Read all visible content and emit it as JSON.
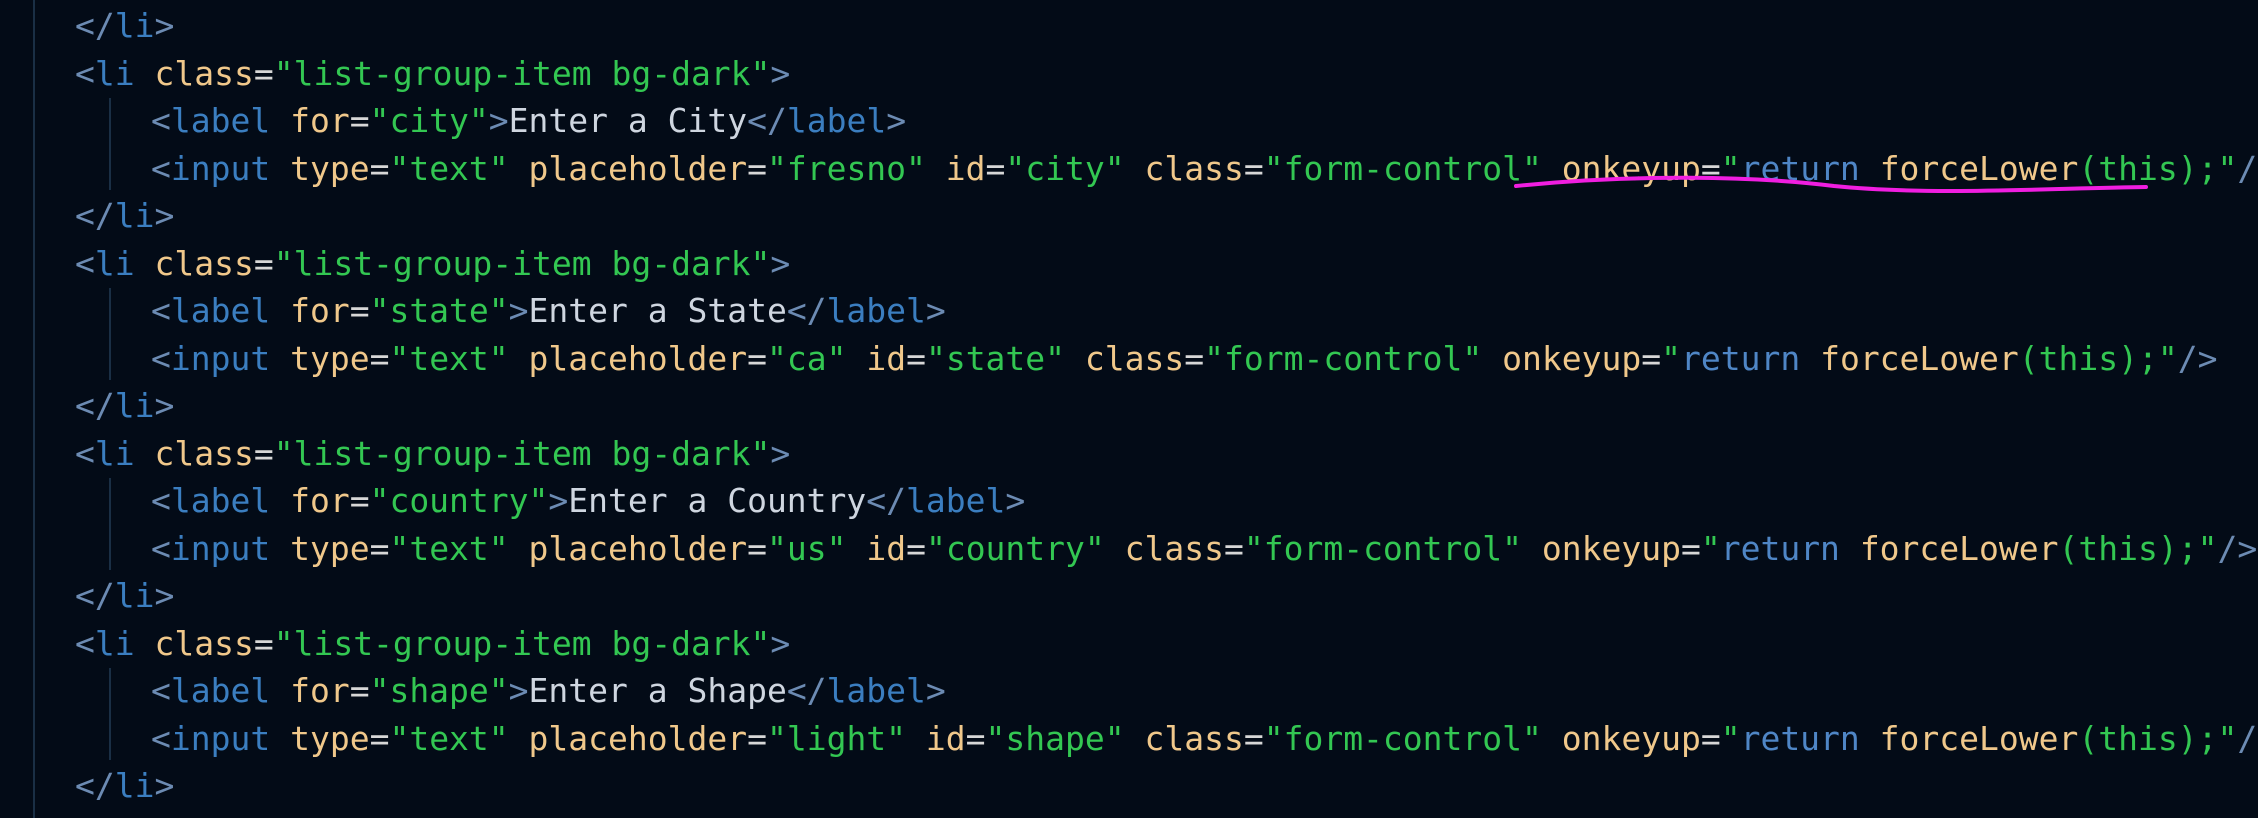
{
  "colors": {
    "background": "#030b17",
    "tag": "#3b7ec0",
    "attribute": "#f0c88b",
    "string": "#33c752",
    "keyword": "#4f86c6",
    "annotation": "#f01ee0"
  },
  "code": {
    "l01": {
      "t1": "</",
      "t2": "li",
      "t3": ">"
    },
    "l02": {
      "t1": "<",
      "t2": "li",
      "t3": " ",
      "t4": "class",
      "t5": "=",
      "t6": "\"list-group-item bg-dark\"",
      "t7": ">"
    },
    "l03": {
      "t1": "<",
      "t2": "label",
      "t3": " ",
      "t4": "for",
      "t5": "=",
      "t6": "\"city\"",
      "t7": ">",
      "t8": "Enter a City",
      "t9": "</",
      "t10": "label",
      "t11": ">"
    },
    "l04": {
      "t1": "<",
      "t2": "input",
      "t3": " ",
      "t4": "type",
      "t5": "=",
      "t6": "\"text\"",
      "t7": " ",
      "t8": "placeholder",
      "t9": "=",
      "t10": "\"fresno\"",
      "t11": " ",
      "t12": "id",
      "t13": "=",
      "t14": "\"city\"",
      "t15": " ",
      "t16": "class",
      "t17": "=",
      "t18": "\"form-control\"",
      "t19": " ",
      "t20": "onkeyup",
      "t21": "=",
      "t22": "\"",
      "t23": "return",
      "t24": " ",
      "t25": "forceLower",
      "t26": "(this);",
      "t27": "\"",
      "t28": "/>"
    },
    "l05": {
      "t1": "</",
      "t2": "li",
      "t3": ">"
    },
    "l06": {
      "t1": "<",
      "t2": "li",
      "t3": " ",
      "t4": "class",
      "t5": "=",
      "t6": "\"list-group-item bg-dark\"",
      "t7": ">"
    },
    "l07": {
      "t1": "<",
      "t2": "label",
      "t3": " ",
      "t4": "for",
      "t5": "=",
      "t6": "\"state\"",
      "t7": ">",
      "t8": "Enter a State",
      "t9": "</",
      "t10": "label",
      "t11": ">"
    },
    "l08": {
      "t1": "<",
      "t2": "input",
      "t3": " ",
      "t4": "type",
      "t5": "=",
      "t6": "\"text\"",
      "t7": " ",
      "t8": "placeholder",
      "t9": "=",
      "t10": "\"ca\"",
      "t11": " ",
      "t12": "id",
      "t13": "=",
      "t14": "\"state\"",
      "t15": " ",
      "t16": "class",
      "t17": "=",
      "t18": "\"form-control\"",
      "t19": " ",
      "t20": "onkeyup",
      "t21": "=",
      "t22": "\"",
      "t23": "return",
      "t24": " ",
      "t25": "forceLower",
      "t26": "(this);",
      "t27": "\"",
      "t28": "/>"
    },
    "l09": {
      "t1": "</",
      "t2": "li",
      "t3": ">"
    },
    "l10": {
      "t1": "<",
      "t2": "li",
      "t3": " ",
      "t4": "class",
      "t5": "=",
      "t6": "\"list-group-item bg-dark\"",
      "t7": ">"
    },
    "l11": {
      "t1": "<",
      "t2": "label",
      "t3": " ",
      "t4": "for",
      "t5": "=",
      "t6": "\"country\"",
      "t7": ">",
      "t8": "Enter a Country",
      "t9": "</",
      "t10": "label",
      "t11": ">"
    },
    "l12": {
      "t1": "<",
      "t2": "input",
      "t3": " ",
      "t4": "type",
      "t5": "=",
      "t6": "\"text\"",
      "t7": " ",
      "t8": "placeholder",
      "t9": "=",
      "t10": "\"us\"",
      "t11": " ",
      "t12": "id",
      "t13": "=",
      "t14": "\"country\"",
      "t15": " ",
      "t16": "class",
      "t17": "=",
      "t18": "\"form-control\"",
      "t19": " ",
      "t20": "onkeyup",
      "t21": "=",
      "t22": "\"",
      "t23": "return",
      "t24": " ",
      "t25": "forceLower",
      "t26": "(this);",
      "t27": "\"",
      "t28": "/>"
    },
    "l13": {
      "t1": "</",
      "t2": "li",
      "t3": ">"
    },
    "l14": {
      "t1": "<",
      "t2": "li",
      "t3": " ",
      "t4": "class",
      "t5": "=",
      "t6": "\"list-group-item bg-dark\"",
      "t7": ">"
    },
    "l15": {
      "t1": "<",
      "t2": "label",
      "t3": " ",
      "t4": "for",
      "t5": "=",
      "t6": "\"shape\"",
      "t7": ">",
      "t8": "Enter a Shape",
      "t9": "</",
      "t10": "label",
      "t11": ">"
    },
    "l16": {
      "t1": "<",
      "t2": "input",
      "t3": " ",
      "t4": "type",
      "t5": "=",
      "t6": "\"text\"",
      "t7": " ",
      "t8": "placeholder",
      "t9": "=",
      "t10": "\"light\"",
      "t11": " ",
      "t12": "id",
      "t13": "=",
      "t14": "\"shape\"",
      "t15": " ",
      "t16": "class",
      "t17": "=",
      "t18": "\"form-control\"",
      "t19": " ",
      "t20": "onkeyup",
      "t21": "=",
      "t22": "\"",
      "t23": "return",
      "t24": " ",
      "t25": "forceLower",
      "t26": "(this);",
      "t27": "\"",
      "t28": "/>"
    },
    "l17": {
      "t1": "</",
      "t2": "li",
      "t3": ">"
    }
  }
}
